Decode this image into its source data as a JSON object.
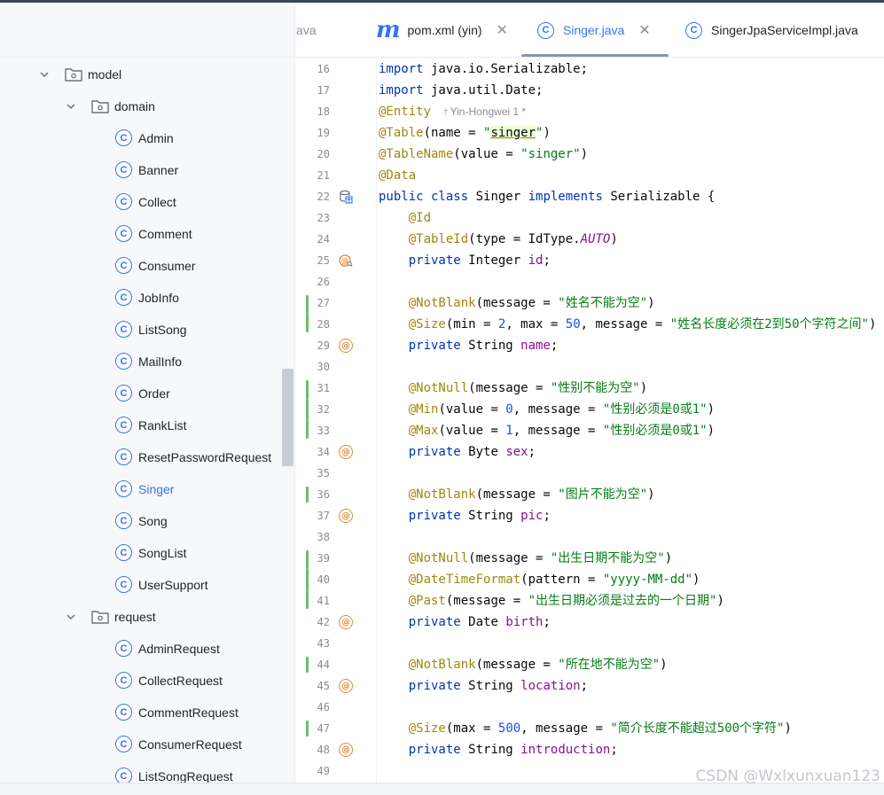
{
  "tree": {
    "items": [
      {
        "label": "model",
        "type": "folder",
        "expanded": true,
        "level": 1
      },
      {
        "label": "domain",
        "type": "folder",
        "expanded": true,
        "level": 2
      },
      {
        "label": "Admin",
        "type": "class",
        "level": 3
      },
      {
        "label": "Banner",
        "type": "class",
        "level": 3
      },
      {
        "label": "Collect",
        "type": "class",
        "level": 3
      },
      {
        "label": "Comment",
        "type": "class",
        "level": 3
      },
      {
        "label": "Consumer",
        "type": "class",
        "level": 3
      },
      {
        "label": "JobInfo",
        "type": "class",
        "level": 3
      },
      {
        "label": "ListSong",
        "type": "class",
        "level": 3
      },
      {
        "label": "MailInfo",
        "type": "class",
        "level": 3
      },
      {
        "label": "Order",
        "type": "class",
        "level": 3
      },
      {
        "label": "RankList",
        "type": "class",
        "level": 3
      },
      {
        "label": "ResetPasswordRequest",
        "type": "class",
        "level": 3
      },
      {
        "label": "Singer",
        "type": "class",
        "level": 3,
        "selected": true
      },
      {
        "label": "Song",
        "type": "class",
        "level": 3
      },
      {
        "label": "SongList",
        "type": "class",
        "level": 3
      },
      {
        "label": "UserSupport",
        "type": "class",
        "level": 3
      },
      {
        "label": "request",
        "type": "folder",
        "expanded": true,
        "level": 2
      },
      {
        "label": "AdminRequest",
        "type": "class",
        "level": 3
      },
      {
        "label": "CollectRequest",
        "type": "class",
        "level": 3
      },
      {
        "label": "CommentRequest",
        "type": "class",
        "level": 3
      },
      {
        "label": "ConsumerRequest",
        "type": "class",
        "level": 3
      },
      {
        "label": "ListSongRequest",
        "type": "class",
        "level": 3
      }
    ]
  },
  "tabs": [
    {
      "label": "ava",
      "icon": "none",
      "closable": false,
      "active": false
    },
    {
      "label": "pom.xml (yin)",
      "icon": "maven-icon",
      "closable": true,
      "active": false
    },
    {
      "label": "Singer.java",
      "icon": "class-icon",
      "closable": true,
      "active": true
    },
    {
      "label": "SingerJpaServiceImpl.java",
      "icon": "class-icon",
      "closable": false,
      "active": false
    }
  ],
  "icons": {
    "class_letter": "C",
    "maven_letter": "m",
    "close_glyph": "✕",
    "chevron_down": "⌄",
    "at_glyph": "@"
  },
  "editor": {
    "author_hint": "Yin-Hongwei 1 *",
    "lines": [
      {
        "n": "16",
        "tokens": [
          [
            "kw",
            "import"
          ],
          [
            "p",
            " java.io.Serializable;"
          ]
        ]
      },
      {
        "n": "17",
        "tokens": [
          [
            "kw",
            "import"
          ],
          [
            "p",
            " java.util.Date;"
          ]
        ]
      },
      {
        "n": "18",
        "tokens": [
          [
            "ann",
            "@Entity"
          ]
        ],
        "author": true
      },
      {
        "n": "19",
        "tokens": [
          [
            "ann",
            "@Table"
          ],
          [
            "p",
            "(name = "
          ],
          [
            "str",
            "\""
          ],
          [
            "hl",
            "singer"
          ],
          [
            "str",
            "\""
          ],
          [
            "p",
            ")"
          ]
        ]
      },
      {
        "n": "20",
        "tokens": [
          [
            "ann",
            "@TableName"
          ],
          [
            "p",
            "(value = "
          ],
          [
            "str",
            "\"singer\""
          ],
          [
            "p",
            ")"
          ]
        ]
      },
      {
        "n": "21",
        "tokens": [
          [
            "ann",
            "@Data"
          ]
        ]
      },
      {
        "n": "22",
        "tokens": [
          [
            "kw",
            "public class"
          ],
          [
            "p",
            " Singer "
          ],
          [
            "kw",
            "implements"
          ],
          [
            "p",
            " Serializable {"
          ]
        ],
        "gutter": "db"
      },
      {
        "n": "23",
        "tokens": [
          [
            "p",
            "    "
          ],
          [
            "ann",
            "@Id"
          ]
        ]
      },
      {
        "n": "24",
        "tokens": [
          [
            "p",
            "    "
          ],
          [
            "ann",
            "@TableId"
          ],
          [
            "p",
            "(type = IdType."
          ],
          [
            "cst",
            "AUTO"
          ],
          [
            "p",
            ")"
          ]
        ]
      },
      {
        "n": "25",
        "tokens": [
          [
            "p",
            "    "
          ],
          [
            "kw",
            "private"
          ],
          [
            "p",
            " Integer "
          ],
          [
            "fld",
            "id"
          ],
          [
            "p",
            ";"
          ]
        ],
        "gutter": "key"
      },
      {
        "n": "26",
        "tokens": []
      },
      {
        "n": "27",
        "tokens": [
          [
            "p",
            "    "
          ],
          [
            "ann",
            "@NotBlank"
          ],
          [
            "p",
            "(message = "
          ],
          [
            "str",
            "\"姓名不能为空\""
          ],
          [
            "p",
            ")"
          ]
        ],
        "bar": true
      },
      {
        "n": "28",
        "tokens": [
          [
            "p",
            "    "
          ],
          [
            "ann",
            "@Size"
          ],
          [
            "p",
            "(min = "
          ],
          [
            "num",
            "2"
          ],
          [
            "p",
            ", max = "
          ],
          [
            "num",
            "50"
          ],
          [
            "p",
            ", message = "
          ],
          [
            "str",
            "\"姓名长度必须在2到50个字符之间\""
          ],
          [
            "p",
            ")"
          ]
        ],
        "bar": true
      },
      {
        "n": "29",
        "tokens": [
          [
            "p",
            "    "
          ],
          [
            "kw",
            "private"
          ],
          [
            "p",
            " String "
          ],
          [
            "fld",
            "name"
          ],
          [
            "p",
            ";"
          ]
        ],
        "gutter": "at"
      },
      {
        "n": "30",
        "tokens": []
      },
      {
        "n": "31",
        "tokens": [
          [
            "p",
            "    "
          ],
          [
            "ann",
            "@NotNull"
          ],
          [
            "p",
            "(message = "
          ],
          [
            "str",
            "\"性别不能为空\""
          ],
          [
            "p",
            ")"
          ]
        ],
        "bar": true
      },
      {
        "n": "32",
        "tokens": [
          [
            "p",
            "    "
          ],
          [
            "ann",
            "@Min"
          ],
          [
            "p",
            "(value = "
          ],
          [
            "num",
            "0"
          ],
          [
            "p",
            ", message = "
          ],
          [
            "str",
            "\"性别必须是0或1\""
          ],
          [
            "p",
            ")"
          ]
        ],
        "bar": true
      },
      {
        "n": "33",
        "tokens": [
          [
            "p",
            "    "
          ],
          [
            "ann",
            "@Max"
          ],
          [
            "p",
            "(value = "
          ],
          [
            "num",
            "1"
          ],
          [
            "p",
            ", message = "
          ],
          [
            "str",
            "\"性别必须是0或1\""
          ],
          [
            "p",
            ")"
          ]
        ],
        "bar": true
      },
      {
        "n": "34",
        "tokens": [
          [
            "p",
            "    "
          ],
          [
            "kw",
            "private"
          ],
          [
            "p",
            " Byte "
          ],
          [
            "fld",
            "sex"
          ],
          [
            "p",
            ";"
          ]
        ],
        "gutter": "at"
      },
      {
        "n": "35",
        "tokens": []
      },
      {
        "n": "36",
        "tokens": [
          [
            "p",
            "    "
          ],
          [
            "ann",
            "@NotBlank"
          ],
          [
            "p",
            "(message = "
          ],
          [
            "str",
            "\"图片不能为空\""
          ],
          [
            "p",
            ")"
          ]
        ],
        "bar": true
      },
      {
        "n": "37",
        "tokens": [
          [
            "p",
            "    "
          ],
          [
            "kw",
            "private"
          ],
          [
            "p",
            " String "
          ],
          [
            "fld",
            "pic"
          ],
          [
            "p",
            ";"
          ]
        ],
        "gutter": "at"
      },
      {
        "n": "38",
        "tokens": []
      },
      {
        "n": "39",
        "tokens": [
          [
            "p",
            "    "
          ],
          [
            "ann",
            "@NotNull"
          ],
          [
            "p",
            "(message = "
          ],
          [
            "str",
            "\"出生日期不能为空\""
          ],
          [
            "p",
            ")"
          ]
        ],
        "bar": true
      },
      {
        "n": "40",
        "tokens": [
          [
            "p",
            "    "
          ],
          [
            "ann",
            "@DateTimeFormat"
          ],
          [
            "p",
            "(pattern = "
          ],
          [
            "str",
            "\"yyyy-MM-dd\""
          ],
          [
            "p",
            ")"
          ]
        ],
        "bar": true
      },
      {
        "n": "41",
        "tokens": [
          [
            "p",
            "    "
          ],
          [
            "ann",
            "@Past"
          ],
          [
            "p",
            "(message = "
          ],
          [
            "str",
            "\"出生日期必须是过去的一个日期\""
          ],
          [
            "p",
            ")"
          ]
        ],
        "bar": true
      },
      {
        "n": "42",
        "tokens": [
          [
            "p",
            "    "
          ],
          [
            "kw",
            "private"
          ],
          [
            "p",
            " Date "
          ],
          [
            "fld",
            "birth"
          ],
          [
            "p",
            ";"
          ]
        ],
        "gutter": "at"
      },
      {
        "n": "43",
        "tokens": []
      },
      {
        "n": "44",
        "tokens": [
          [
            "p",
            "    "
          ],
          [
            "ann",
            "@NotBlank"
          ],
          [
            "p",
            "(message = "
          ],
          [
            "str",
            "\"所在地不能为空\""
          ],
          [
            "p",
            ")"
          ]
        ],
        "bar": true
      },
      {
        "n": "45",
        "tokens": [
          [
            "p",
            "    "
          ],
          [
            "kw",
            "private"
          ],
          [
            "p",
            " String "
          ],
          [
            "fld",
            "location"
          ],
          [
            "p",
            ";"
          ]
        ],
        "gutter": "at"
      },
      {
        "n": "46",
        "tokens": []
      },
      {
        "n": "47",
        "tokens": [
          [
            "p",
            "    "
          ],
          [
            "ann",
            "@Size"
          ],
          [
            "p",
            "(max = "
          ],
          [
            "num",
            "500"
          ],
          [
            "p",
            ", message = "
          ],
          [
            "str",
            "\"简介长度不能超过500个字符\""
          ],
          [
            "p",
            ")"
          ]
        ],
        "bar": true
      },
      {
        "n": "48",
        "tokens": [
          [
            "p",
            "    "
          ],
          [
            "kw",
            "private"
          ],
          [
            "p",
            " String "
          ],
          [
            "fld",
            "introduction"
          ],
          [
            "p",
            ";"
          ]
        ],
        "gutter": "at"
      },
      {
        "n": "49",
        "tokens": []
      }
    ]
  },
  "watermark": "CSDN @Wxlxunxuan123",
  "colors": {
    "accent": "#3574f0",
    "annotation": "#9e880d",
    "string": "#067d17",
    "keyword": "#0033b3",
    "field": "#871094",
    "number": "#1750eb",
    "change_bar": "#6ebc6e",
    "gutter_icon": "#e58a3a"
  }
}
